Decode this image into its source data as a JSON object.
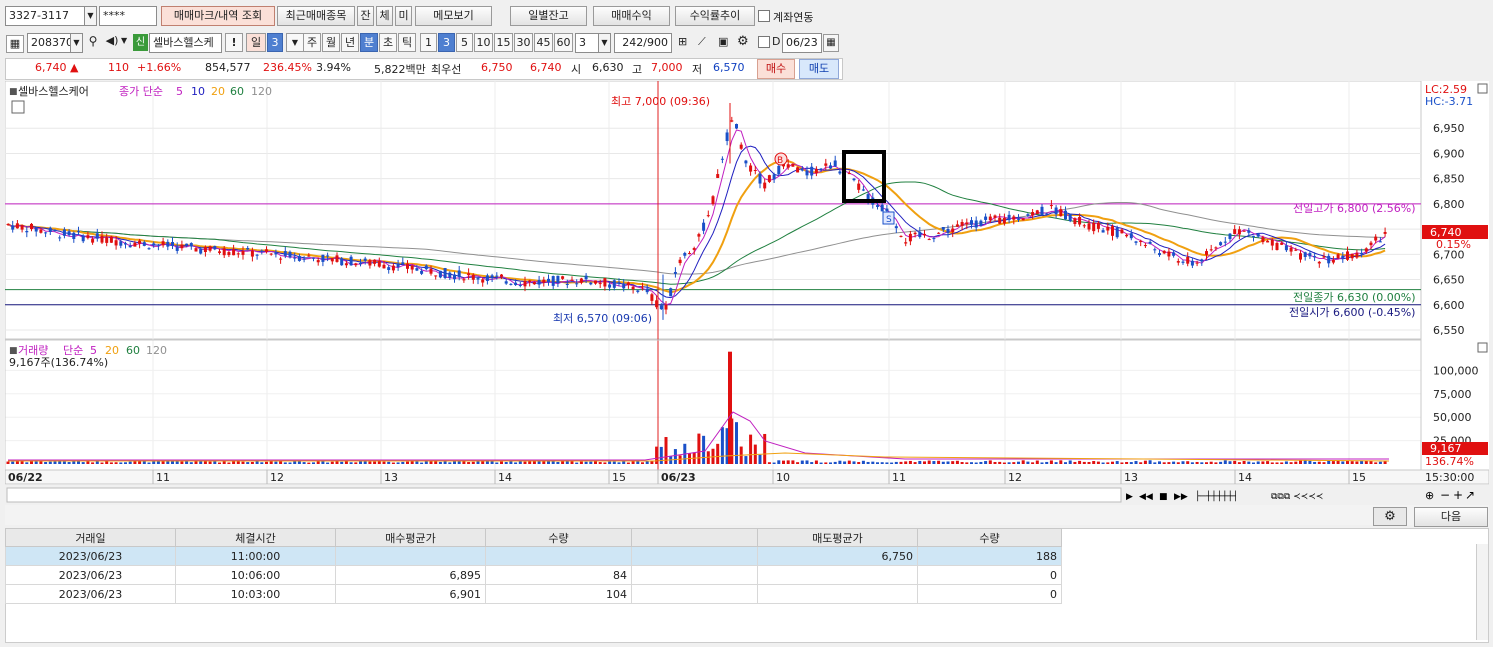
{
  "top": {
    "account": "3327-3117",
    "password": "****",
    "btn_trade_mark": "매매마크/내역 조회",
    "btn_recent": "최근매매종목",
    "btn_jan": "잔",
    "btn_che": "체",
    "btn_mi": "미",
    "btn_memo": "메모보기",
    "btn_daily": "일별잔고",
    "btn_profit": "매매수익",
    "btn_rate": "수익률추이",
    "link_label": "계좌연동"
  },
  "toolbar2": {
    "code": "208370",
    "name": "셀바스헬스케",
    "badge": "신",
    "excl": "!",
    "periods": [
      "일",
      "3",
      "주",
      "월",
      "년",
      "분",
      "초",
      "틱"
    ],
    "minutes": [
      "1",
      "3",
      "5",
      "10",
      "15",
      "30",
      "45",
      "60"
    ],
    "minute_value": "3",
    "count": "242/900",
    "d_label": "D",
    "date": "06/23"
  },
  "quote": {
    "price": "6,740",
    "arrow": "▲",
    "change": "110",
    "change_pct": "+1.66%",
    "volume": "854,577",
    "vol_ratio": "236.45%",
    "turnover": "3.94%",
    "amount": "5,822백만",
    "best_label": "최우선",
    "best_ask": "6,750",
    "best_bid": "6,740",
    "open_label": "시",
    "open": "6,630",
    "high_label": "고",
    "high": "7,000",
    "low_label": "저",
    "low": "6,570",
    "buy_btn": "매수",
    "sell_btn": "매도"
  },
  "price_pane": {
    "name": "셀바스헬스케어",
    "ma_label": "종가 단순",
    "ma_periods": [
      "5",
      "10",
      "20",
      "60",
      "120"
    ],
    "lc": "LC:2.59",
    "hc": "HC:-3.71",
    "high_annot": "최고 7,000 (09:36)",
    "low_annot": "최저 6,570 (09:06)",
    "prev_high_line": "전일고가 6,800 (2.56%)",
    "prev_close_line": "전일종가 6,630 (0.00%)",
    "prev_open_line": "전일시가 6,600 (-0.45%)",
    "cur_price_tag": "6,740",
    "cur_pct_tag": "0.15%",
    "buy_marker": "B",
    "sell_marker": "S",
    "y_ticks": [
      "6,950",
      "6,900",
      "6,850",
      "6,800",
      "6,750",
      "6,700",
      "6,650",
      "6,600",
      "6,550"
    ]
  },
  "volume_pane": {
    "label": "거래량",
    "ma_label": "단순",
    "ma_periods": [
      "5",
      "20",
      "60",
      "120"
    ],
    "current": "9,167주(136.74%)",
    "y_ticks": [
      "100,000",
      "75,000",
      "50,000",
      "25,000"
    ],
    "cur_tag": "9,167",
    "cur_pct_tag": "136.74%"
  },
  "x_axis": {
    "labels": [
      "06/22",
      "11",
      "12",
      "13",
      "14",
      "15",
      "06/23",
      "10",
      "11",
      "12",
      "13",
      "14",
      "15"
    ],
    "end_time": "15:30:00"
  },
  "colors": {
    "up": "#e01010",
    "down": "#1a50c8",
    "ma5": "#c020c0",
    "ma10": "#2020c0",
    "ma20": "#f0a010",
    "ma60": "#208040",
    "ma120": "#909090"
  },
  "chart_data": {
    "type": "candlestick",
    "range": [
      "2023-06-22",
      "2023-06-23"
    ],
    "ylim": [
      6550,
      7000
    ],
    "prev_high": 6800,
    "prev_close": 6630,
    "prev_open": 6600,
    "day_high": 7000,
    "day_low": 6570,
    "current": 6740,
    "volume_ylim": [
      0,
      125000
    ],
    "peak_volume": 120000
  },
  "trades": {
    "headers": [
      "거래일",
      "체결시간",
      "매수평균가",
      "수량",
      "",
      "매도평균가",
      "수량"
    ],
    "rows": [
      [
        "2023/06/23",
        "11:00:00",
        "",
        "",
        "",
        "6,750",
        "188"
      ],
      [
        "2023/06/23",
        "10:06:00",
        "6,895",
        "84",
        "",
        "",
        "0"
      ],
      [
        "2023/06/23",
        "10:03:00",
        "6,901",
        "104",
        "",
        "",
        "0"
      ]
    ],
    "next_btn": "다음"
  }
}
